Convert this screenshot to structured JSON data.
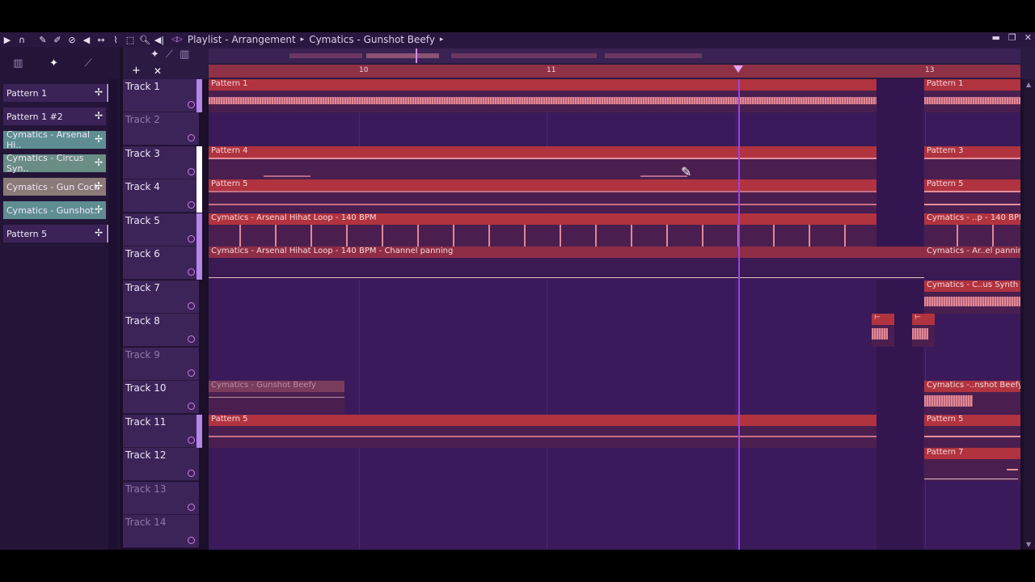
{
  "title": {
    "app_title": "Playlist - Arrangement",
    "pattern_name": "Cymatics - Gunshot Beefy"
  },
  "browser": {
    "items": [
      {
        "label": "Pattern 1",
        "type": "pattern"
      },
      {
        "label": "Pattern 1 #2",
        "type": "pattern"
      },
      {
        "label": "Cymatics - Arsenal Hi..",
        "type": "audio"
      },
      {
        "label": "Cymatics - Circus Syn..",
        "type": "audio"
      },
      {
        "label": "Cymatics - Gun Cock",
        "type": "audio"
      },
      {
        "label": "Cymatics - Gunshot..",
        "type": "audio"
      },
      {
        "label": "Pattern 5",
        "type": "pattern"
      }
    ]
  },
  "ruler": {
    "bars": [
      "10",
      "11",
      "13"
    ]
  },
  "tracks": [
    {
      "name": "Track 1"
    },
    {
      "name": "Track 2"
    },
    {
      "name": "Track 3"
    },
    {
      "name": "Track 4"
    },
    {
      "name": "Track 5"
    },
    {
      "name": "Track 6"
    },
    {
      "name": "Track 7"
    },
    {
      "name": "Track 8"
    },
    {
      "name": "Track 9"
    },
    {
      "name": "Track 10"
    },
    {
      "name": "Track 11"
    },
    {
      "name": "Track 12"
    },
    {
      "name": "Track 13"
    },
    {
      "name": "Track 14"
    }
  ],
  "clips": {
    "t1a": "Pattern 1",
    "t1b": "Pattern 1",
    "t3a": "Pattern 4",
    "t3b": "Pattern 3",
    "t4a": "Pattern 5",
    "t4b": "Pattern 5",
    "t5a": "Cymatics - Arsenal Hihat Loop - 140 BPM",
    "t5b": "Cymatics - ..p - 140 BPM",
    "t6a": "Cymatics - Arsenal Hihat Loop - 140 BPM - Channel panning",
    "t6b": "Cymatics - Ar..el panning",
    "t7b": "Cymatics - C..us Synth FX",
    "t10a": "Cymatics - Gunshot Beefy",
    "t10b": "Cymatics -..nshot Beefy",
    "t11a": "Pattern 5",
    "t11b": "Pattern 5",
    "t12b": "Pattern 7"
  },
  "colors": {
    "accent": "#9a43e8",
    "clip_header": "#b0333f",
    "audio_item": "#5e8e92"
  }
}
